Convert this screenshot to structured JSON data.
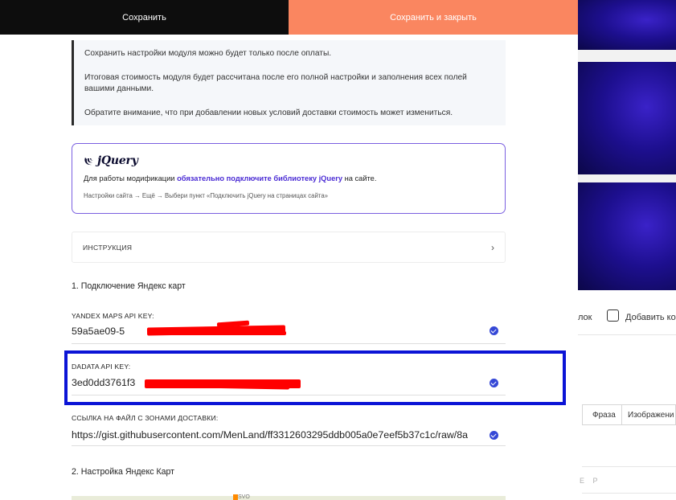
{
  "toolbar": {
    "save_label": "Сохранить",
    "save_close_label": "Сохранить и закрыть"
  },
  "notice": {
    "line1": "Сохранить настройки модуля можно будет только после оплаты.",
    "line2": "Итоговая стоимость модуля будет рассчитана после его полной настройки и заполнения всех полей вашими данными.",
    "line3": "Обратите внимание, что при добавлении новых условий доставки стоимость может измениться."
  },
  "jquery_box": {
    "brand": "jQuery",
    "text_before": "Для работы модификации ",
    "text_highlight": "обязательно подключите библиотеку jQuery",
    "text_after": " на сайте.",
    "path": "Настройки сайта → Ещё → Выбери пункт «Подключить jQuery на страницах сайта»"
  },
  "instruction": {
    "label": "ИНСТРУКЦИЯ",
    "chevron": "›"
  },
  "section1": {
    "title": "1. Подключение Яндекс карт"
  },
  "fields": [
    {
      "label": "YANDEX MAPS API KEY:",
      "value": "59a5ae09-5",
      "verified": true
    },
    {
      "label": "DADATA API KEY:",
      "value": "3ed0dd3761f3",
      "verified": true
    },
    {
      "label": "ССЫЛКА НА ФАЙЛ С ЗОНАМИ ДОСТАВКИ:",
      "value": "https://gist.githubusercontent.com/MenLand/ff3312603295ddb005a0e7eef5b37c1c/raw/8a",
      "verified": true
    }
  ],
  "section2": {
    "title": "2. Настройка Яндекс Карт"
  },
  "background": {
    "toolbar_fragment": "лок",
    "toolbar_add": "Добавить ко",
    "table_col1": "Фраза",
    "table_col2": "Изображени",
    "faded_letters": "Е Р",
    "map_label": "SVO"
  },
  "colors": {
    "save_bg": "#0d0d0d",
    "save_close_bg": "#fa8660",
    "accent_purple": "#4a2bd4",
    "check_blue": "#3548d6",
    "highlight_border": "#0b14d6",
    "redaction": "#ff0000"
  },
  "icons": {
    "check": "check-circle-icon",
    "chevron": "chevron-right-icon",
    "jquery": "jquery-logo-icon",
    "chat": "comment-icon"
  }
}
